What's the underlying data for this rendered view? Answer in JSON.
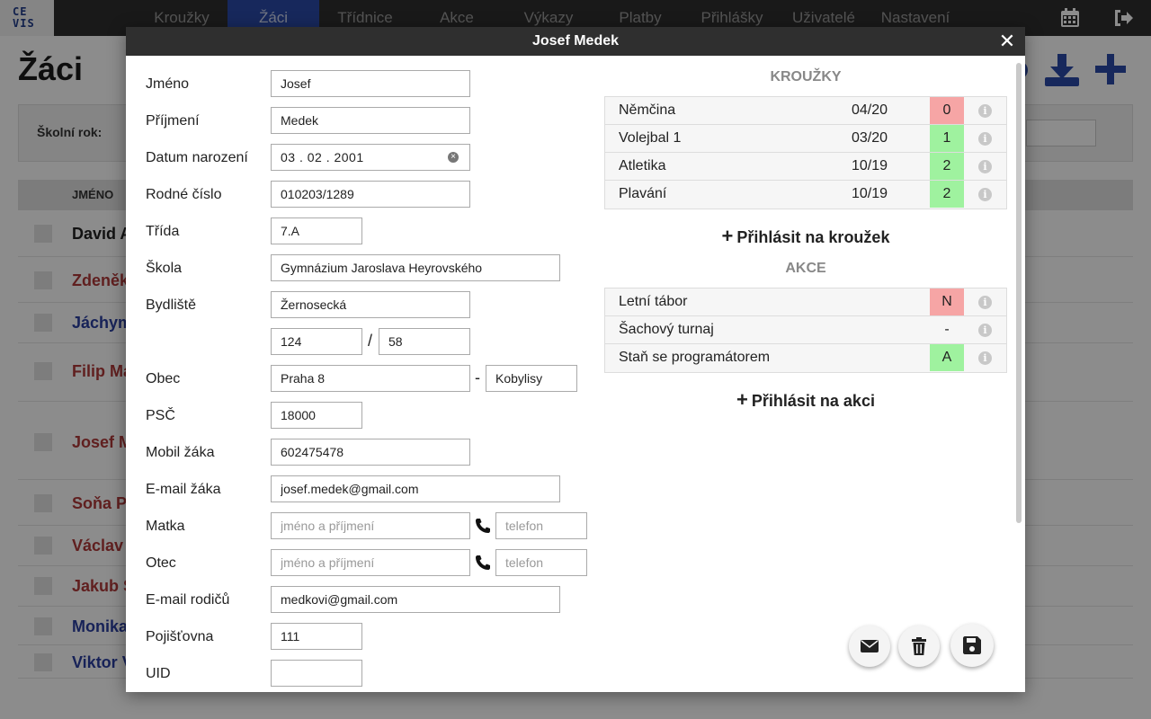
{
  "app": {
    "logo_line1": "CE",
    "logo_line2": "VIS",
    "nav": [
      "Kroužky",
      "Žáci",
      "Třídnice",
      "Akce",
      "Výkazy",
      "Platby",
      "Přihlášky",
      "Uživatelé",
      "Nastavení"
    ],
    "active_nav": "Žáci"
  },
  "page": {
    "title": "Žáci",
    "filter_label": "Školní rok:",
    "col_header": "JMÉNO",
    "rows": [
      {
        "name": "David A",
        "color": "#222222"
      },
      {
        "name": "Zdeněk",
        "color": "#b03a3a"
      },
      {
        "name": "Jáchym",
        "color": "#2a3fa0"
      },
      {
        "name": "Filip Ma",
        "color": "#b03a3a"
      },
      {
        "name": "Josef M",
        "color": "#b03a3a"
      },
      {
        "name": "Soňa Po",
        "color": "#b03a3a"
      },
      {
        "name": "Václav",
        "color": "#b03a3a"
      },
      {
        "name": "Jakub S",
        "color": "#b03a3a"
      },
      {
        "name": "Monika",
        "color": "#2a3fa0"
      },
      {
        "name": "Viktor V",
        "color": "#2a3fa0"
      }
    ]
  },
  "modal": {
    "title": "Josef Medek",
    "close": "✕",
    "labels": {
      "jmeno": "Jméno",
      "prijmeni": "Příjmení",
      "datum": "Datum narození",
      "rodne": "Rodné číslo",
      "trida": "Třída",
      "skola": "Škola",
      "bydliste": "Bydliště",
      "obec": "Obec",
      "psc": "PSČ",
      "mobil": "Mobil žáka",
      "email": "E-mail žáka",
      "matka": "Matka",
      "otec": "Otec",
      "email_rodicu": "E-mail rodičů",
      "pojistovna": "Pojišťovna",
      "uid": "UID"
    },
    "values": {
      "jmeno": "Josef",
      "prijmeni": "Medek",
      "datum": "03 . 02 . 2001",
      "rodne": "010203/1289",
      "trida": "7.A",
      "skola": "Gymnázium Jaroslava Heyrovského",
      "ulice": "Žernosecká",
      "cislo_popisne": "124",
      "cislo_orientacni": "58",
      "obec": "Praha 8",
      "cast_obce": "Kobylisy",
      "psc": "18000",
      "mobil": "602475478",
      "email": "josef.medek@gmail.com",
      "email_rodicu": "medkovi@gmail.com",
      "pojistovna": "111",
      "uid": ""
    },
    "placeholders": {
      "parent_name": "jméno a příjmení",
      "parent_phone": "telefon"
    },
    "separators": {
      "slash": "/",
      "dash": "-"
    },
    "krouzky": {
      "title": "KROUŽKY",
      "items": [
        {
          "name": "Němčina",
          "term": "04/20",
          "status": "0",
          "color": "#f6a5a5"
        },
        {
          "name": "Volejbal 1",
          "term": "03/20",
          "status": "1",
          "color": "#9ff29f"
        },
        {
          "name": "Atletika",
          "term": "10/19",
          "status": "2",
          "color": "#9ff29f"
        },
        {
          "name": "Plavání",
          "term": "10/19",
          "status": "2",
          "color": "#9ff29f"
        }
      ],
      "add_label": "Přihlásit na kroužek"
    },
    "akce": {
      "title": "AKCE",
      "items": [
        {
          "name": "Letní tábor",
          "status": "N",
          "color": "#f6a5a5"
        },
        {
          "name": "Šachový turnaj",
          "status": "-",
          "color": ""
        },
        {
          "name": "Staň se programátorem",
          "status": "A",
          "color": "#9ff29f"
        }
      ],
      "add_label": "Přihlásit na akci"
    },
    "info_glyph": "i",
    "plus_glyph": "+"
  }
}
